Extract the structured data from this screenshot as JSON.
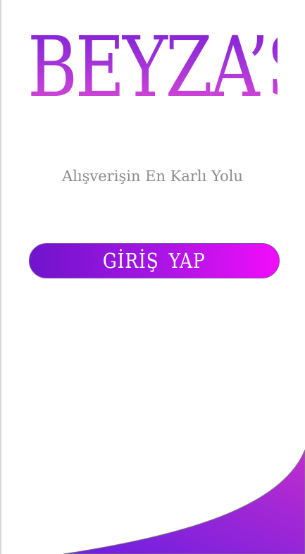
{
  "brand": {
    "title": "BEYZA’S"
  },
  "tagline": "Alışverişin En Karlı Yolu",
  "login": {
    "label": "GİRİŞ YAP"
  },
  "colors": {
    "accent_start": "#6f14cc",
    "accent_end": "#f20dfa",
    "tagline_text": "#8c8c8c",
    "background": "#ffffff"
  }
}
